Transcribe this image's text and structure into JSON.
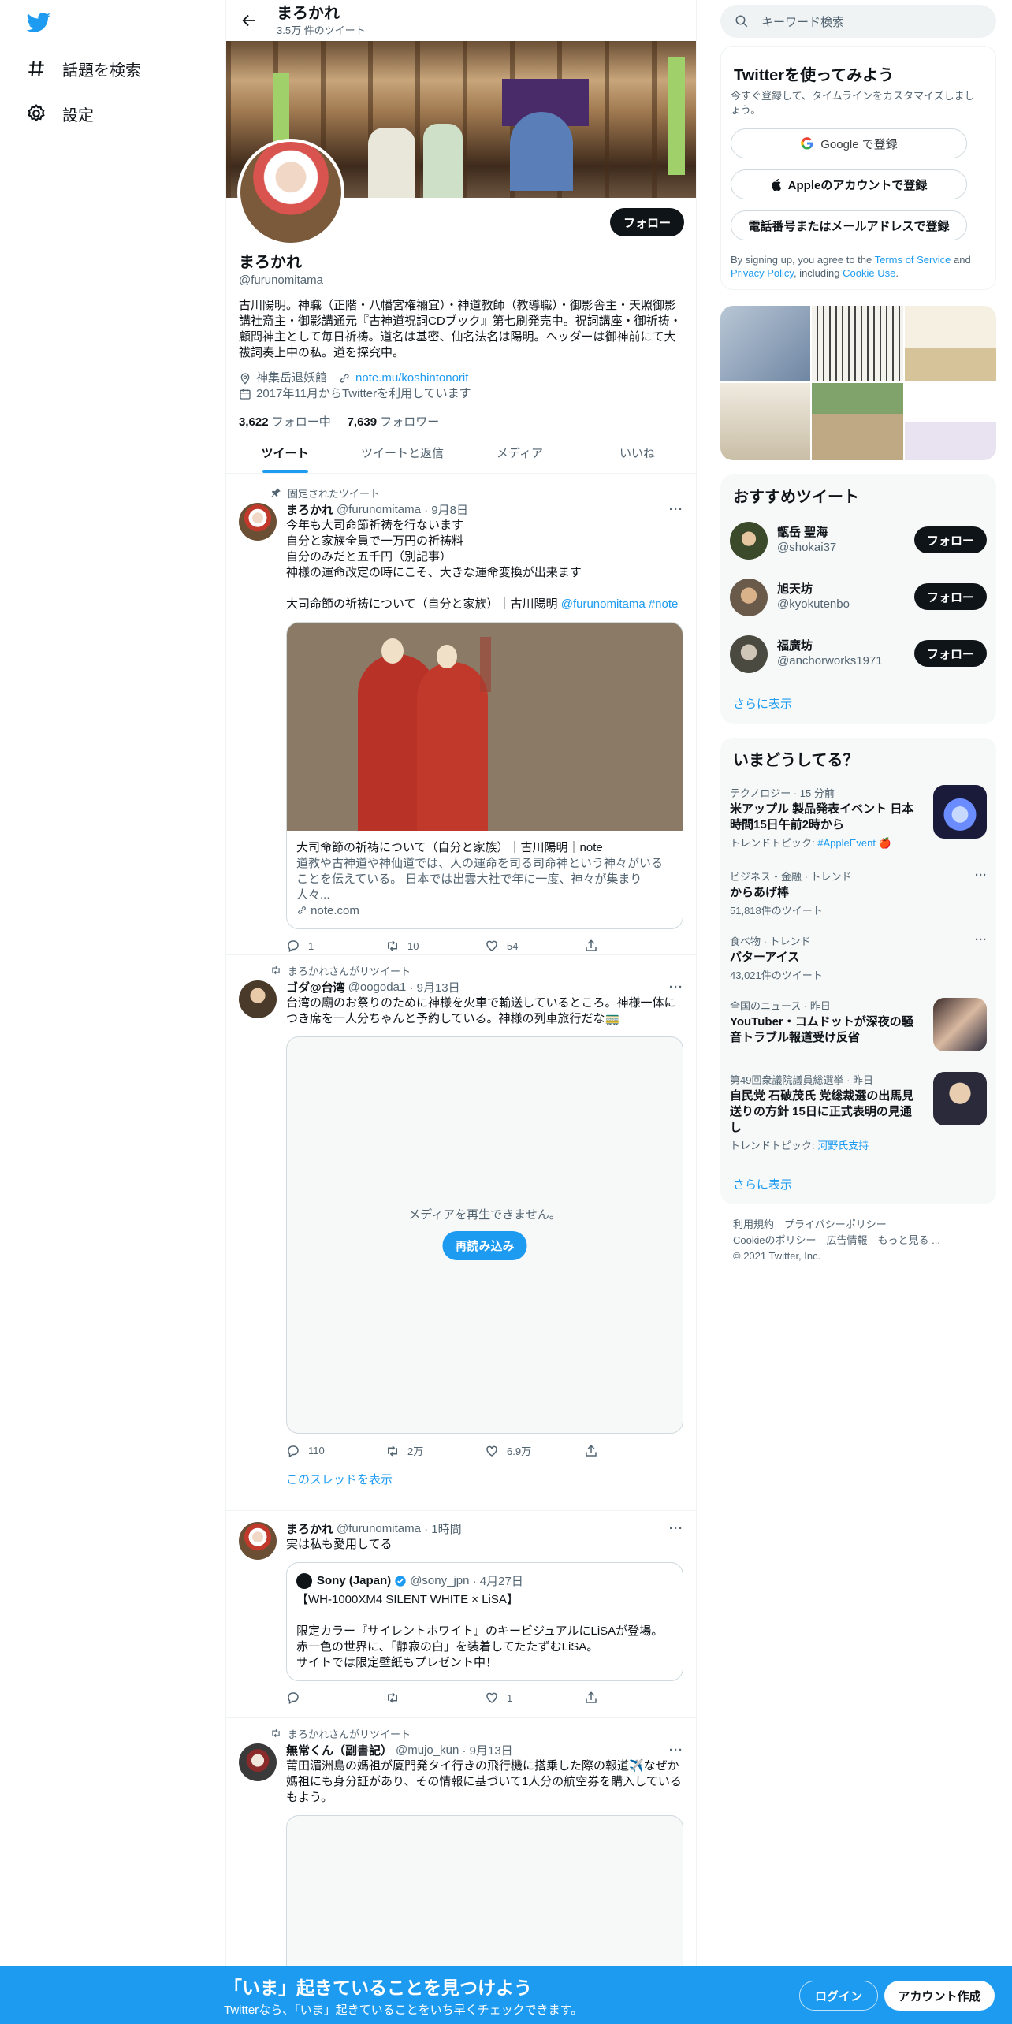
{
  "nav": {
    "explore_label": "話題を検索",
    "settings_label": "設定"
  },
  "header": {
    "name": "まろかれ",
    "tweet_count": "3.5万 件のツイート"
  },
  "profile": {
    "follow_label": "フォロー",
    "name": "まろかれ",
    "handle": "@furunomitama",
    "bio": "古川陽明。神職（正階・八幡宮権禰宜）・神道教師（教導職）・御影舎主・天照御影講社斎主・御影講通元『古神道祝詞CDブック』第七刷発売中。祝詞講座・御祈祷・顧問神主として毎日祈祷。道名は基密、仙名法名は陽明。ヘッダーは御神前にて大祓詞奏上中の私。道を探究中。",
    "location": "神集岳退妖館",
    "link": "note.mu/koshintonorit",
    "joined": "2017年11月からTwitterを利用しています",
    "following_count": "3,622",
    "following_label": "フォロー中",
    "followers_count": "7,639",
    "followers_label": "フォロワー"
  },
  "tabs": [
    "ツイート",
    "ツイートと返信",
    "メディア",
    "いいね"
  ],
  "tweets": [
    {
      "context": "固定されたツイート",
      "name": "まろかれ",
      "handle": "@furunomitama",
      "date": "· 9月8日",
      "text": "今年も大司命節祈祷を行ないます\n自分と家族全員で一万円の祈祷料\n自分のみだと五千円（別記事）\n神様の運命改定の時にこそ、大きな運命変換が出来ます\n\n大司命節の祈祷について（自分と家族）｜古川陽明 ",
      "text_mention": "@furunomitama",
      "text_tag": " #note",
      "card_title": "大司命節の祈祷について（自分と家族）｜古川陽明｜note",
      "card_desc": "道教や古神道や神仙道では、人の運命を司る司命神という神々がいることを伝えている。 日本では出雲大社で年に一度、神々が集まり人々...",
      "card_domain": "note.com",
      "replies": "1",
      "retweets": "10",
      "likes": "54"
    },
    {
      "context": "まろかれさんがリツイート",
      "name": "ゴダ@台湾",
      "handle": "@oogoda1",
      "date": "· 9月13日",
      "text": "台湾の廟のお祭りのために神様を火車で輸送しているところ。神様一体につき席を一人分ちゃんと予約している。神様の列車旅行だな🚃",
      "media_msg": "メディアを再生できません。",
      "reload_label": "再読み込み",
      "replies": "110",
      "retweets": "2万",
      "likes": "6.9万",
      "thread_link": "このスレッドを表示"
    },
    {
      "name": "まろかれ",
      "handle": "@furunomitama",
      "date": "· 1時間",
      "text": "実は私も愛用してる",
      "quote_name": "Sony (Japan)",
      "quote_handle": "@sony_jpn",
      "quote_date": "· 4月27日",
      "quote_text": "【WH-1000XM4 SILENT WHITE × LiSA】\n\n限定カラー『サイレントホワイト』のキービジュアルにLiSAが登場。\n赤一色の世界に、「静寂の白」を装着してたたずむLiSA。\nサイトでは限定壁紙もプレゼント中！",
      "replies": "",
      "retweets": "",
      "likes": "1"
    },
    {
      "context": "まろかれさんがリツイート",
      "name": "無常くん（副書記）",
      "handle": "@mujo_kun",
      "date": "· 9月13日",
      "text": "莆田湄洲島の媽祖が厦門発タイ行きの飛行機に搭乗した際の報道✈️なぜか媽祖にも身分証があり、その情報に基づいて1人分の航空券を購入しているもよう。"
    }
  ],
  "right": {
    "search_placeholder": "キーワード検索",
    "signup_title": "Twitterを使ってみよう",
    "signup_sub": "今すぐ登録して、タイムラインをカスタマイズしましょう。",
    "google_btn": "Google で登録",
    "apple_btn": "Appleのアカウントで登録",
    "phone_btn": "電話番号またはメールアドレスで登録",
    "terms_pre": "By signing up, you agree to the ",
    "terms_link": "Terms of Service",
    "terms_and": " and ",
    "privacy_link": "Privacy Policy",
    "terms_including": ", including ",
    "cookie_link": "Cookie Use",
    "terms_end": ".",
    "who_title": "おすすめツイート",
    "who": [
      {
        "name": "甑岳 聖海",
        "handle": "@shokai37",
        "btn": "フォロー"
      },
      {
        "name": "旭天坊",
        "handle": "@kyokutenbo",
        "btn": "フォロー"
      },
      {
        "name": "福廣坊",
        "handle": "@anchorworks1971",
        "btn": "フォロー"
      }
    ],
    "who_more": "さらに表示",
    "trends_title": "いまどうしてる？",
    "trends": [
      {
        "meta": "テクノロジー · 15 分前",
        "title": "米アップル 製品発表イベント 日本時間15日午前2時から",
        "sub_pre": "トレンドトピック: ",
        "sub_link": "#AppleEvent 🍎"
      },
      {
        "meta": "ビジネス・金融 · トレンド",
        "title": "からあげ棒",
        "sub": "51,818件のツイート"
      },
      {
        "meta": "食べ物 · トレンド",
        "title": "バターアイス",
        "sub": "43,021件のツイート"
      },
      {
        "meta": "全国のニュース · 昨日",
        "title": "YouTuber・コムドットが深夜の騒音トラブル報道受け反省"
      },
      {
        "meta": "第49回衆議院議員総選挙 · 昨日",
        "title": "自民党 石破茂氏 党総裁選の出馬見送りの方針 15日に正式表明の見通し",
        "sub_pre": "トレンドトピック: ",
        "sub_link": "河野氏支持"
      }
    ],
    "trends_more": "さらに表示",
    "footer_line1": "利用規約　プライバシーポリシー",
    "footer_line2": "Cookieのポリシー　広告情報　もっと見る ...",
    "footer_line3": "© 2021 Twitter, Inc."
  },
  "bottom": {
    "headline": "「いま」起きていることを見つけよう",
    "sub": "Twitterなら、「いま」起きていることをいち早くチェックできます。",
    "login": "ログイン",
    "signup": "アカウント作成"
  },
  "colors": {
    "accent": "#1d9bf0",
    "text": "#0f1419",
    "muted": "#536471"
  }
}
